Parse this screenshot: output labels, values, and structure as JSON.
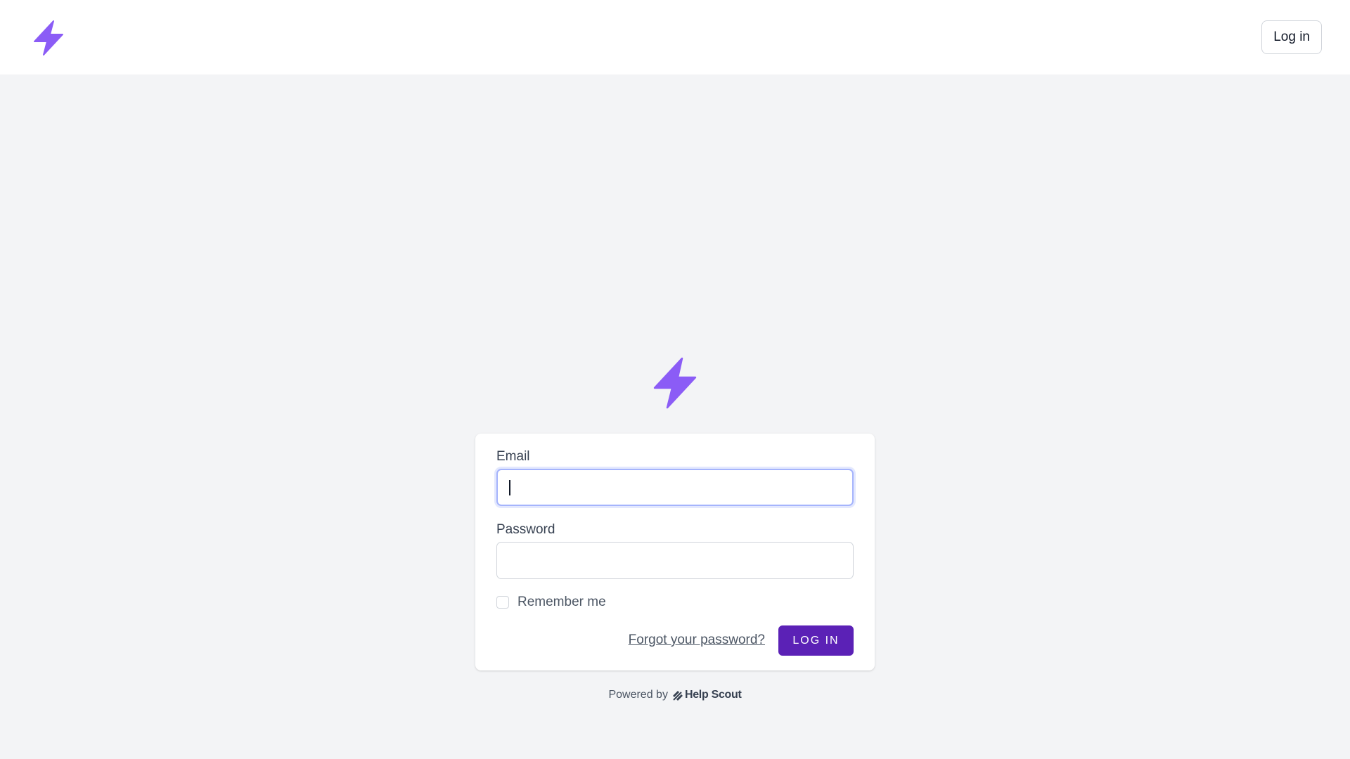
{
  "header": {
    "logo_icon": "lightning-bolt-icon",
    "login_label": "Log in"
  },
  "main": {
    "logo_icon": "lightning-bolt-icon",
    "accent_color": "#8b5cf6",
    "form": {
      "email_label": "Email",
      "email_value": "",
      "password_label": "Password",
      "password_value": "",
      "remember_label": "Remember me",
      "remember_checked": false,
      "forgot_label": "Forgot your password?",
      "submit_label": "LOG IN",
      "submit_color": "#5b21b6"
    }
  },
  "footer": {
    "powered_by": "Powered by",
    "brand_icon": "help-scout-icon",
    "brand_name": "Help Scout"
  }
}
